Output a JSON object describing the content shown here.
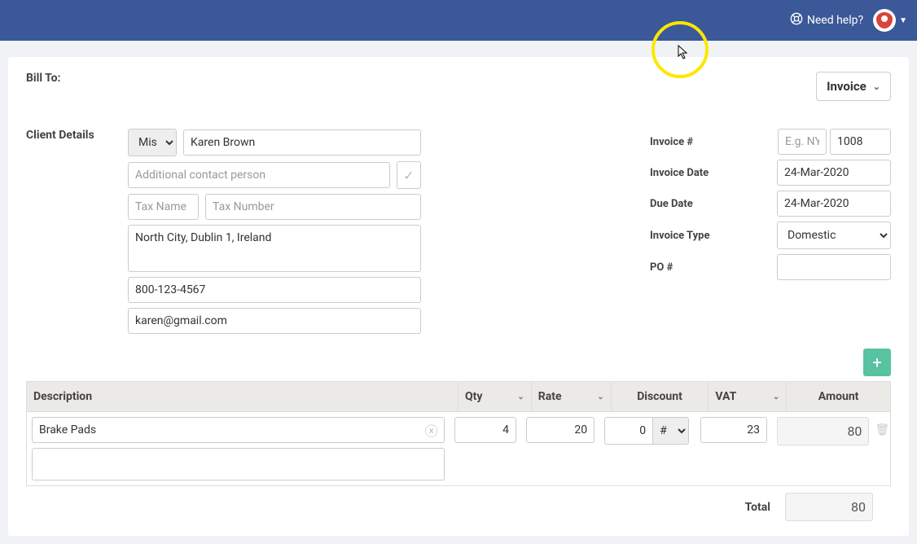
{
  "header": {
    "help_label": "Need help?"
  },
  "bill_to_label": "Bill To:",
  "doc_type": "Invoice",
  "client_details_label": "Client Details",
  "client": {
    "title": "Miss",
    "name": "Karen Brown",
    "additional_placeholder": "Additional contact person",
    "tax_name_placeholder": "Tax Name",
    "tax_number_placeholder": "Tax Number",
    "address": "North City, Dublin 1, Ireland",
    "phone": "800-123-4567",
    "email": "karen@gmail.com"
  },
  "meta": {
    "invoice_no_label": "Invoice #",
    "prefix_placeholder": "E.g. NYC",
    "number": "1008",
    "invoice_date_label": "Invoice Date",
    "invoice_date": "24-Mar-2020",
    "due_date_label": "Due Date",
    "due_date": "24-Mar-2020",
    "invoice_type_label": "Invoice Type",
    "invoice_type": "Domestic",
    "po_label": "PO #"
  },
  "columns": {
    "description": "Description",
    "qty": "Qty",
    "rate": "Rate",
    "discount": "Discount",
    "vat": "VAT",
    "amount": "Amount"
  },
  "line": {
    "description": "Brake Pads",
    "qty": "4",
    "rate": "20",
    "discount": "0",
    "discount_type": "#",
    "vat": "23",
    "amount": "80"
  },
  "totals": {
    "total_label": "Total",
    "total_value": "80"
  }
}
